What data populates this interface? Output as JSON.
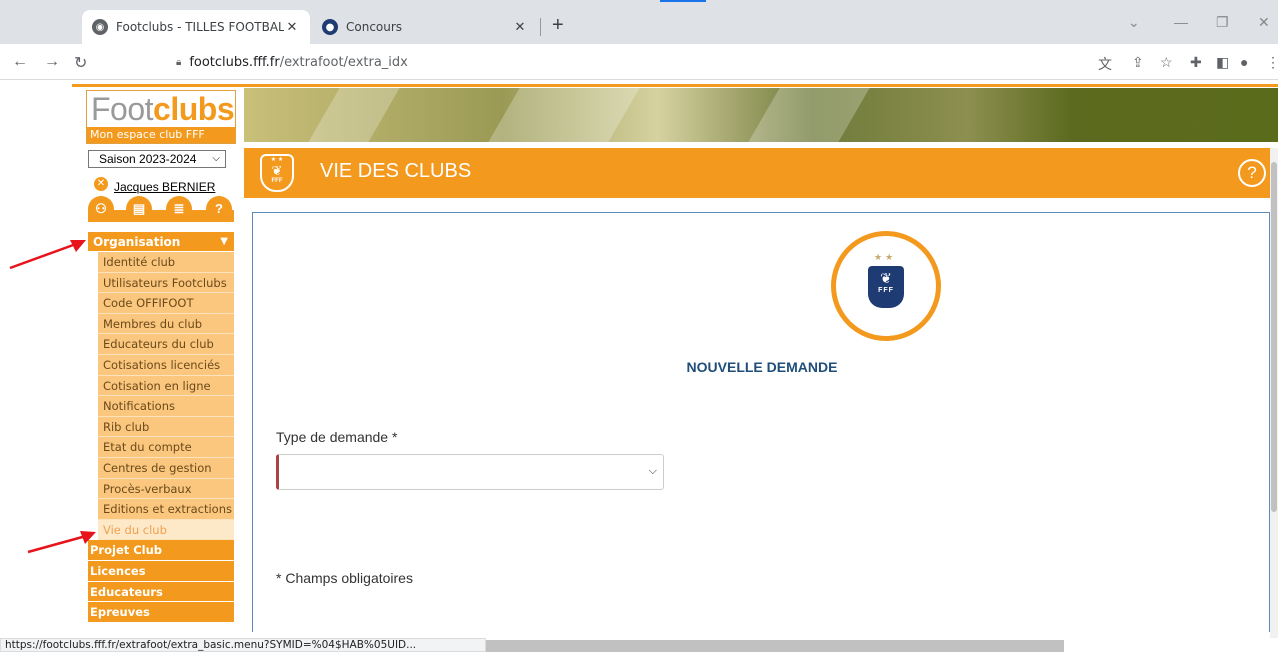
{
  "browser": {
    "tabs": [
      {
        "title": "Footclubs - TILLES FOOTBALL CLUB",
        "active": true
      },
      {
        "title": "Concours",
        "active": false
      }
    ],
    "url_host": "footclubs.fff.fr",
    "url_path": "/extrafoot/extra_idx",
    "status_url": "https://footclubs.fff.fr/extrafoot/extra_basic.menu?SYMID=%04$HAB%05UID..."
  },
  "logo": {
    "foot": "Foot",
    "clubs": "clubs",
    "tagline": "Mon espace club FFF"
  },
  "season": {
    "selected": "Saison 2023-2024"
  },
  "user": {
    "name": "Jacques BERNIER"
  },
  "sidebar": {
    "organisation": "Organisation",
    "items": [
      {
        "label": "Identité club"
      },
      {
        "label": "Utilisateurs Footclubs"
      },
      {
        "label": "Code OFFIFOOT"
      },
      {
        "label": "Membres du club"
      },
      {
        "label": "Educateurs du club"
      },
      {
        "label": "Cotisations licenciés"
      },
      {
        "label": "Cotisation en ligne"
      },
      {
        "label": "Notifications"
      },
      {
        "label": "Rib club"
      },
      {
        "label": "Etat du compte"
      },
      {
        "label": "Centres de gestion"
      },
      {
        "label": "Procès-verbaux"
      },
      {
        "label": "Editions et extractions"
      },
      {
        "label": "Vie du club"
      }
    ],
    "sections": [
      "Projet Club",
      "Licences",
      "Educateurs",
      "Epreuves"
    ]
  },
  "page": {
    "title": "VIE DES CLUBS",
    "help": "?",
    "emblem_text": "FFF",
    "heading": "NOUVELLE DEMANDE",
    "type_label": "Type de demande *",
    "type_value": "",
    "required_note": "* Champs obligatoires"
  },
  "colors": {
    "accent": "#f39a1e",
    "heading": "#1f4e79",
    "arrow": "#e8141c"
  }
}
